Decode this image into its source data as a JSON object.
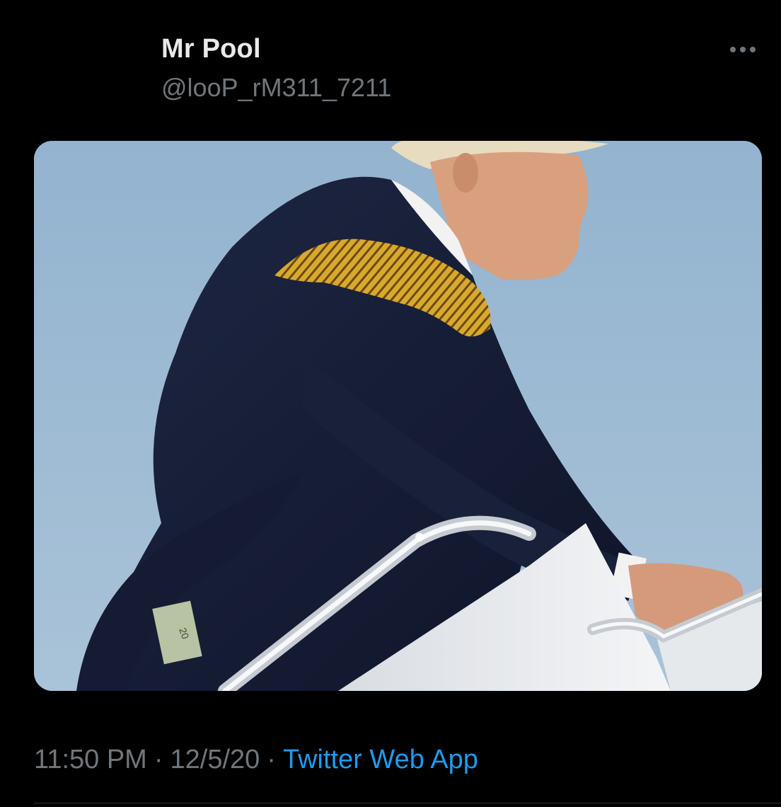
{
  "tweet": {
    "author": {
      "name": "Mr Pool",
      "handle": "@looP_rM311_7211"
    },
    "media": {
      "note": "20"
    },
    "meta": {
      "time": "11:50 PM",
      "date": "12/5/20",
      "separator": "·",
      "source": "Twitter Web App"
    }
  },
  "icons": {
    "more": "more-dots-icon"
  },
  "colors": {
    "background": "#000000",
    "text_primary": "#e7e9ea",
    "text_secondary": "#71767b",
    "link": "#1d9bf0"
  }
}
